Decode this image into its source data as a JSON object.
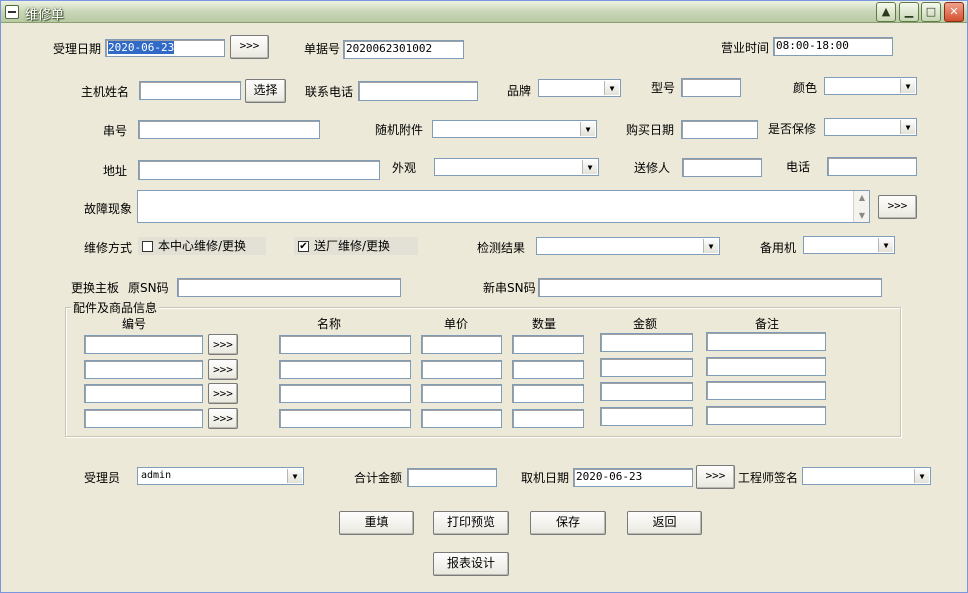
{
  "window": {
    "title": "维修单"
  },
  "titlebar_buttons": {
    "help": "▲",
    "minimize": "▁",
    "maximize": "□",
    "close": "✕"
  },
  "form": {
    "accept_date_label": "受理日期",
    "accept_date_value": "2020-06-23",
    "arrow_label": ">>>",
    "doc_no_label": "单据号",
    "doc_no_value": "2020062301002",
    "business_hours_label": "营业时间",
    "business_hours_value": "08:00-18:00",
    "host_name_label": "主机姓名",
    "host_name_value": "",
    "select_button": "选择",
    "phone_label": "联系电话",
    "phone_value": "",
    "brand_label": "品牌",
    "brand_value": "",
    "model_label": "型号",
    "model_value": "",
    "color_label": "颜色",
    "color_value": "",
    "serial_label": "串号",
    "serial_value": "",
    "accessory_label": "随机附件",
    "accessory_value": "",
    "purchase_date_label": "购买日期",
    "purchase_date_value": "",
    "warranty_label": "是否保修",
    "warranty_value": "",
    "address_label": "地址",
    "address_value": "",
    "appearance_label": "外观",
    "appearance_value": "",
    "sender_label": "送修人",
    "sender_value": "",
    "tel_label": "电话",
    "tel_value": "",
    "fault_label": "故障现象",
    "fault_value": "",
    "repair_mode_label": "维修方式",
    "repair_center_label": "本中心维修/更换",
    "repair_center_checked": "",
    "repair_factory_label": "送厂维修/更换",
    "repair_factory_checked": "✔",
    "test_result_label": "检测结果",
    "test_result_value": "",
    "backup_label": "备用机",
    "backup_value": "",
    "replace_board_label": "更换主板",
    "orig_sn_label": "原SN码",
    "orig_sn_value": "",
    "new_sn_label": "新串SN码",
    "new_sn_value": ""
  },
  "parts": {
    "legend": "配件及商品信息",
    "headers": {
      "code": "编号",
      "name": "名称",
      "price": "单价",
      "qty": "数量",
      "amount": "金额",
      "remark": "备注"
    },
    "rows": [
      {
        "code": "",
        "name": "",
        "price": "",
        "qty": "",
        "amount": "",
        "remark": ""
      },
      {
        "code": "",
        "name": "",
        "price": "",
        "qty": "",
        "amount": "",
        "remark": ""
      },
      {
        "code": "",
        "name": "",
        "price": "",
        "qty": "",
        "amount": "",
        "remark": ""
      },
      {
        "code": "",
        "name": "",
        "price": "",
        "qty": "",
        "amount": "",
        "remark": ""
      }
    ]
  },
  "footer": {
    "receiver_label": "受理员",
    "receiver_value": "admin",
    "total_label": "合计金额",
    "total_value": "",
    "pickup_date_label": "取机日期",
    "pickup_date_value": "2020-06-23",
    "engineer_label": "工程师签名",
    "engineer_value": ""
  },
  "actions": {
    "reset": "重填",
    "print_preview": "打印预览",
    "save": "保存",
    "back": "返回",
    "report_design": "报表设计"
  },
  "glyphs": {
    "dropdown": "▼",
    "scroll_up": "▲",
    "scroll_down": "▼"
  }
}
